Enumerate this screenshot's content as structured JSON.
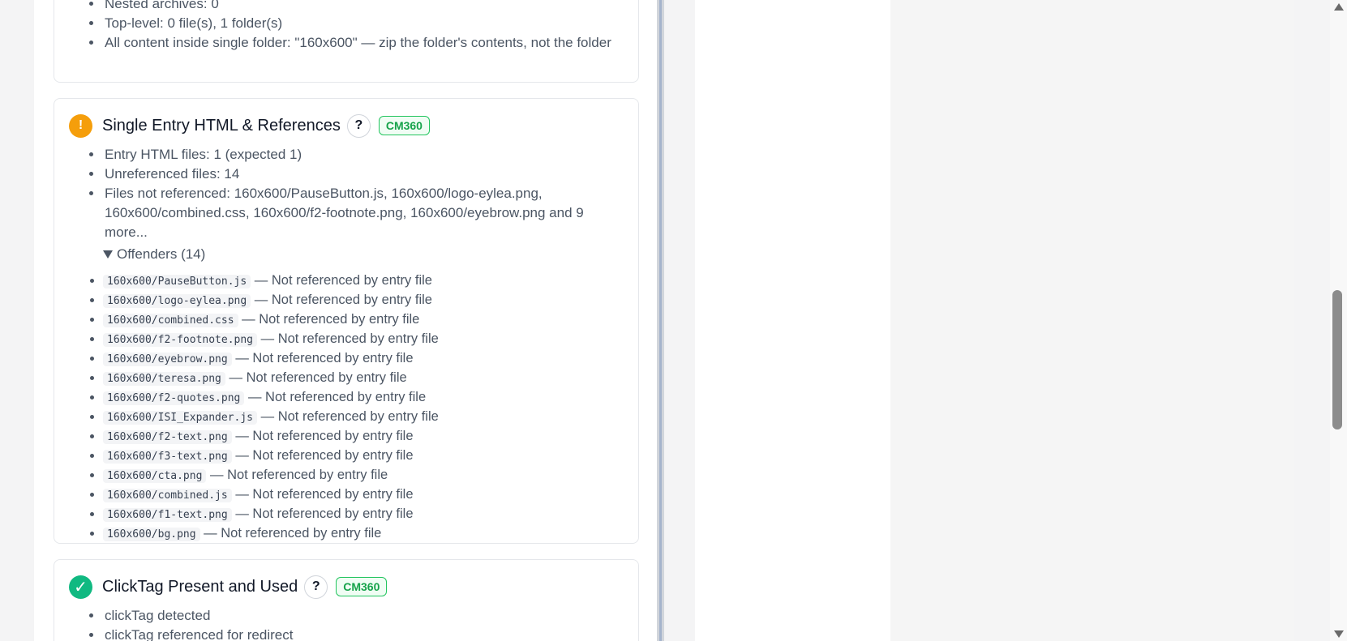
{
  "card_top": {
    "items": [
      "Nested archives: 0",
      "Top-level: 0 file(s), 1 folder(s)",
      "All content inside single folder: \"160x600\" — zip the folder's contents, not the folder"
    ]
  },
  "card_entry": {
    "status": "warning",
    "status_glyph": "!",
    "title": "Single Entry HTML & References",
    "help_label": "?",
    "badge": "CM360",
    "items": [
      "Entry HTML files: 1 (expected 1)",
      "Unreferenced files: 14",
      "Files not referenced: 160x600/PauseButton.js, 160x600/logo-eylea.png, 160x600/combined.css, 160x600/f2-footnote.png, 160x600/eyebrow.png and 9 more..."
    ],
    "offenders_label": "Offenders (14)",
    "offender_suffix": "— Not referenced by entry file",
    "offenders": [
      "160x600/PauseButton.js",
      "160x600/logo-eylea.png",
      "160x600/combined.css",
      "160x600/f2-footnote.png",
      "160x600/eyebrow.png",
      "160x600/teresa.png",
      "160x600/f2-quotes.png",
      "160x600/ISI_Expander.js",
      "160x600/f2-text.png",
      "160x600/f3-text.png",
      "160x600/cta.png",
      "160x600/combined.js",
      "160x600/f1-text.png",
      "160x600/bg.png"
    ]
  },
  "card_clicktag": {
    "status": "pass",
    "status_glyph": "✓",
    "title": "ClickTag Present and Used",
    "help_label": "?",
    "badge": "CM360",
    "items": [
      "clickTag detected",
      "clickTag referenced for redirect"
    ]
  },
  "colors": {
    "warning": "#f59e0b",
    "pass": "#10b981",
    "badge": "#16a34a"
  }
}
